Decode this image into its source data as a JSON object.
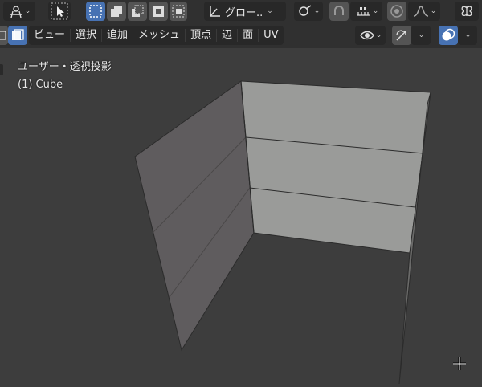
{
  "header": {
    "transform_orientation": "グロー..",
    "icons": [
      "transform-pivot-icon",
      "select-tool-icon",
      "mode-new-icon",
      "mode-extend-icon",
      "mode-subtract-icon",
      "mode-intersect-icon",
      "transform-orientation-icon",
      "snap-link-icon",
      "snap-magnet-icon",
      "snap-increment-icon",
      "proportional-edit-icon",
      "falloff-curve-icon",
      "mirror-butterfly-icon"
    ]
  },
  "menubar": {
    "items": [
      "ビュー",
      "選択",
      "追加",
      "メッシュ",
      "頂点",
      "辺",
      "面",
      "UV"
    ]
  },
  "viewport": {
    "view_label": "ユーザー・透視投影",
    "object_label": "(1) Cube"
  },
  "colors": {
    "background": "#3d3d3d",
    "header": "#303030",
    "button": "#545454",
    "active_blue": "#4772b3",
    "face_light": "#9a9b99",
    "face_dark": "#5f5c5e"
  }
}
